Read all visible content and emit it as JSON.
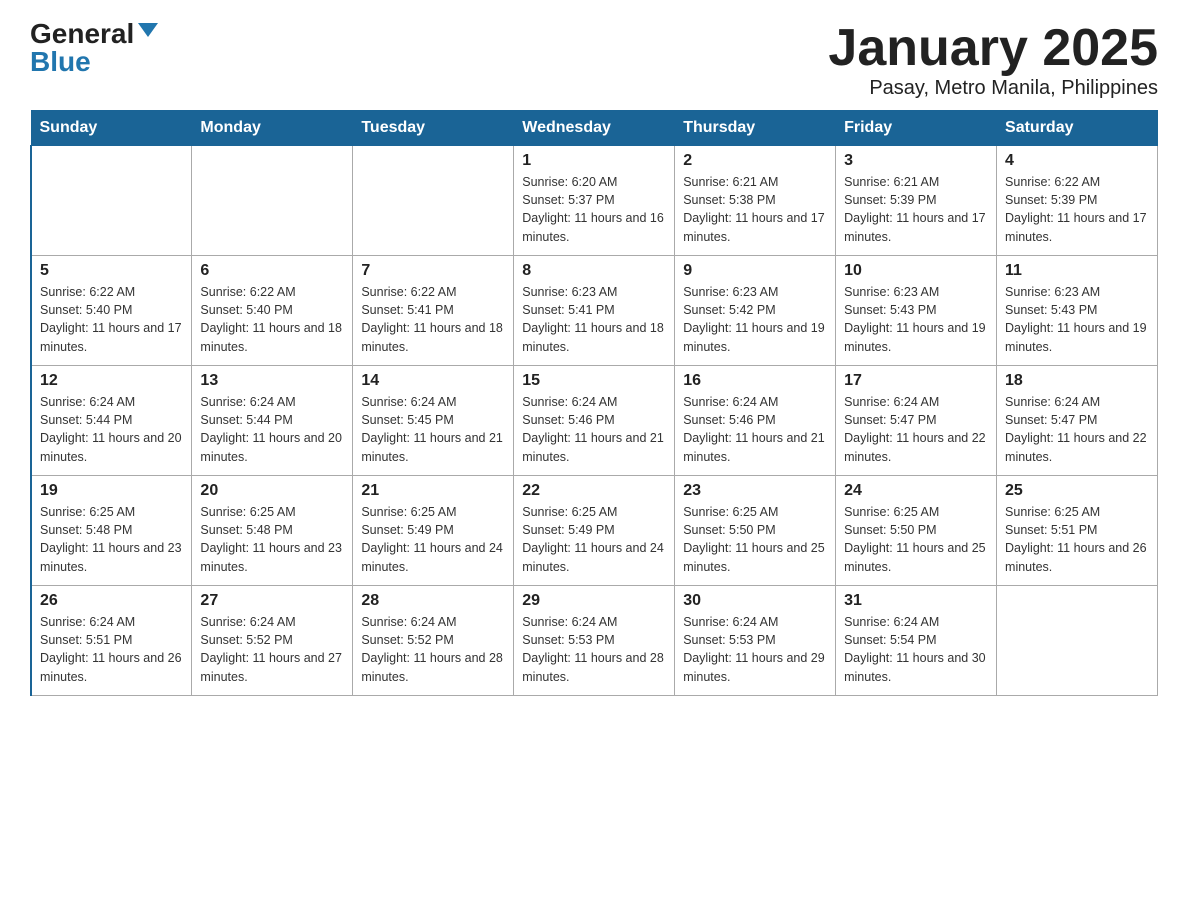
{
  "header": {
    "logo_general": "General",
    "logo_blue": "Blue",
    "title": "January 2025",
    "subtitle": "Pasay, Metro Manila, Philippines"
  },
  "days_of_week": [
    "Sunday",
    "Monday",
    "Tuesday",
    "Wednesday",
    "Thursday",
    "Friday",
    "Saturday"
  ],
  "weeks": [
    [
      {
        "day": "",
        "info": ""
      },
      {
        "day": "",
        "info": ""
      },
      {
        "day": "",
        "info": ""
      },
      {
        "day": "1",
        "info": "Sunrise: 6:20 AM\nSunset: 5:37 PM\nDaylight: 11 hours and 16 minutes."
      },
      {
        "day": "2",
        "info": "Sunrise: 6:21 AM\nSunset: 5:38 PM\nDaylight: 11 hours and 17 minutes."
      },
      {
        "day": "3",
        "info": "Sunrise: 6:21 AM\nSunset: 5:39 PM\nDaylight: 11 hours and 17 minutes."
      },
      {
        "day": "4",
        "info": "Sunrise: 6:22 AM\nSunset: 5:39 PM\nDaylight: 11 hours and 17 minutes."
      }
    ],
    [
      {
        "day": "5",
        "info": "Sunrise: 6:22 AM\nSunset: 5:40 PM\nDaylight: 11 hours and 17 minutes."
      },
      {
        "day": "6",
        "info": "Sunrise: 6:22 AM\nSunset: 5:40 PM\nDaylight: 11 hours and 18 minutes."
      },
      {
        "day": "7",
        "info": "Sunrise: 6:22 AM\nSunset: 5:41 PM\nDaylight: 11 hours and 18 minutes."
      },
      {
        "day": "8",
        "info": "Sunrise: 6:23 AM\nSunset: 5:41 PM\nDaylight: 11 hours and 18 minutes."
      },
      {
        "day": "9",
        "info": "Sunrise: 6:23 AM\nSunset: 5:42 PM\nDaylight: 11 hours and 19 minutes."
      },
      {
        "day": "10",
        "info": "Sunrise: 6:23 AM\nSunset: 5:43 PM\nDaylight: 11 hours and 19 minutes."
      },
      {
        "day": "11",
        "info": "Sunrise: 6:23 AM\nSunset: 5:43 PM\nDaylight: 11 hours and 19 minutes."
      }
    ],
    [
      {
        "day": "12",
        "info": "Sunrise: 6:24 AM\nSunset: 5:44 PM\nDaylight: 11 hours and 20 minutes."
      },
      {
        "day": "13",
        "info": "Sunrise: 6:24 AM\nSunset: 5:44 PM\nDaylight: 11 hours and 20 minutes."
      },
      {
        "day": "14",
        "info": "Sunrise: 6:24 AM\nSunset: 5:45 PM\nDaylight: 11 hours and 21 minutes."
      },
      {
        "day": "15",
        "info": "Sunrise: 6:24 AM\nSunset: 5:46 PM\nDaylight: 11 hours and 21 minutes."
      },
      {
        "day": "16",
        "info": "Sunrise: 6:24 AM\nSunset: 5:46 PM\nDaylight: 11 hours and 21 minutes."
      },
      {
        "day": "17",
        "info": "Sunrise: 6:24 AM\nSunset: 5:47 PM\nDaylight: 11 hours and 22 minutes."
      },
      {
        "day": "18",
        "info": "Sunrise: 6:24 AM\nSunset: 5:47 PM\nDaylight: 11 hours and 22 minutes."
      }
    ],
    [
      {
        "day": "19",
        "info": "Sunrise: 6:25 AM\nSunset: 5:48 PM\nDaylight: 11 hours and 23 minutes."
      },
      {
        "day": "20",
        "info": "Sunrise: 6:25 AM\nSunset: 5:48 PM\nDaylight: 11 hours and 23 minutes."
      },
      {
        "day": "21",
        "info": "Sunrise: 6:25 AM\nSunset: 5:49 PM\nDaylight: 11 hours and 24 minutes."
      },
      {
        "day": "22",
        "info": "Sunrise: 6:25 AM\nSunset: 5:49 PM\nDaylight: 11 hours and 24 minutes."
      },
      {
        "day": "23",
        "info": "Sunrise: 6:25 AM\nSunset: 5:50 PM\nDaylight: 11 hours and 25 minutes."
      },
      {
        "day": "24",
        "info": "Sunrise: 6:25 AM\nSunset: 5:50 PM\nDaylight: 11 hours and 25 minutes."
      },
      {
        "day": "25",
        "info": "Sunrise: 6:25 AM\nSunset: 5:51 PM\nDaylight: 11 hours and 26 minutes."
      }
    ],
    [
      {
        "day": "26",
        "info": "Sunrise: 6:24 AM\nSunset: 5:51 PM\nDaylight: 11 hours and 26 minutes."
      },
      {
        "day": "27",
        "info": "Sunrise: 6:24 AM\nSunset: 5:52 PM\nDaylight: 11 hours and 27 minutes."
      },
      {
        "day": "28",
        "info": "Sunrise: 6:24 AM\nSunset: 5:52 PM\nDaylight: 11 hours and 28 minutes."
      },
      {
        "day": "29",
        "info": "Sunrise: 6:24 AM\nSunset: 5:53 PM\nDaylight: 11 hours and 28 minutes."
      },
      {
        "day": "30",
        "info": "Sunrise: 6:24 AM\nSunset: 5:53 PM\nDaylight: 11 hours and 29 minutes."
      },
      {
        "day": "31",
        "info": "Sunrise: 6:24 AM\nSunset: 5:54 PM\nDaylight: 11 hours and 30 minutes."
      },
      {
        "day": "",
        "info": ""
      }
    ]
  ]
}
